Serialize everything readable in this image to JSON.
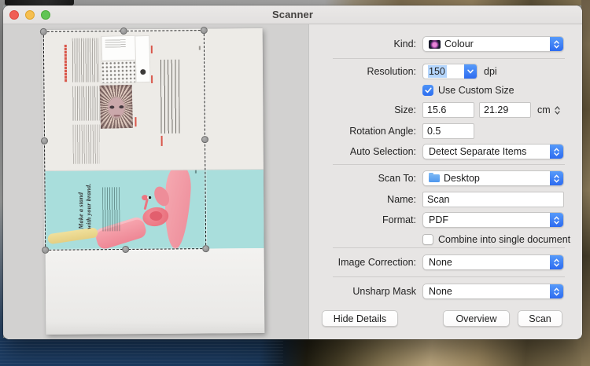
{
  "titlebar": {
    "title": "Scanner"
  },
  "preview": {
    "teal_caption": {
      "line1": "Make a stand",
      "line2": "with your brand."
    }
  },
  "form": {
    "kind": {
      "label": "Kind:",
      "value": "Colour"
    },
    "resolution": {
      "label": "Resolution:",
      "value": "150",
      "unit": "dpi"
    },
    "use_custom_size": {
      "label": "Use Custom Size",
      "checked": true
    },
    "size": {
      "label": "Size:",
      "width_value": "15.6",
      "height_value": "21.29",
      "unit": "cm"
    },
    "rotation_angle": {
      "label": "Rotation Angle:",
      "value": "0.5"
    },
    "auto_selection": {
      "label": "Auto Selection:",
      "value": "Detect Separate Items"
    },
    "scan_to": {
      "label": "Scan To:",
      "value": "Desktop"
    },
    "name_field": {
      "label": "Name:",
      "value": "Scan"
    },
    "format": {
      "label": "Format:",
      "value": "PDF"
    },
    "combine": {
      "label": "Combine into single document",
      "checked": false
    },
    "image_correction": {
      "label": "Image Correction:",
      "value": "None"
    },
    "unsharp_mask": {
      "label": "Unsharp Mask",
      "value": "None"
    }
  },
  "footer": {
    "hide_details": "Hide Details",
    "overview": "Overview",
    "scan": "Scan"
  },
  "colors": {
    "accent_blue": "#3578f6",
    "selection_highlight": "#b4d5fc",
    "teal_page": "#a9dedc",
    "pink_board": "#f09aa3",
    "red_accent": "#d9564a"
  }
}
